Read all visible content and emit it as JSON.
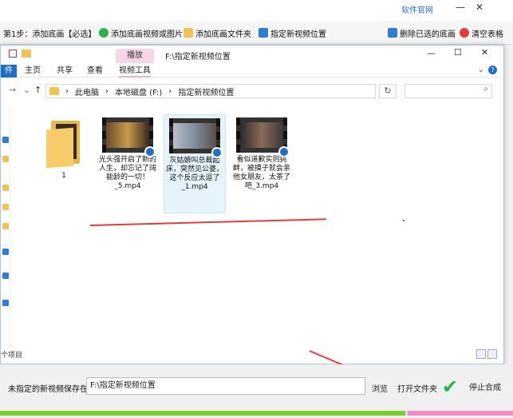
{
  "top": {
    "link": "软件官网",
    "min": "—",
    "close": "✕"
  },
  "toolbar": {
    "step": "第1步：添加底画【必选】",
    "add_media": "添加底画视频或图片",
    "add_folder": "添加底画文件夹",
    "set_location": "指定新视频位置",
    "delete_selected": "删除已选的底画",
    "clear_table": "清空表格"
  },
  "explorer": {
    "context_tab": "播放",
    "title": "F:\\指定新视频位置",
    "ribbon_tabs": [
      "件",
      "主页",
      "共享",
      "查看",
      "视频工具"
    ],
    "address": {
      "parts": [
        "此电脑",
        "本地磁盘 (F:)",
        "指定新视频位置"
      ]
    },
    "item_count": "个项目",
    "files": [
      {
        "name": "1"
      },
      {
        "name": "光头强开启了新的人生，却忘记了阔能龄的一切！_5.mp4"
      },
      {
        "name": "灰姑娘叫总裁起床，突然见公婆，这个反应太逗了_1.mp4"
      },
      {
        "name": "看似道歉实则挑衅，被摸子就会亲他女朋友，太茶了吧_3.mp4"
      }
    ]
  },
  "savebar": {
    "label": "未指定的新视频保存在:",
    "path": "F:\\指定新视频位置",
    "browse": "浏览",
    "open_folder": "打开文件夹",
    "stop": "停止合成"
  },
  "progress": {
    "value": 0.79
  }
}
